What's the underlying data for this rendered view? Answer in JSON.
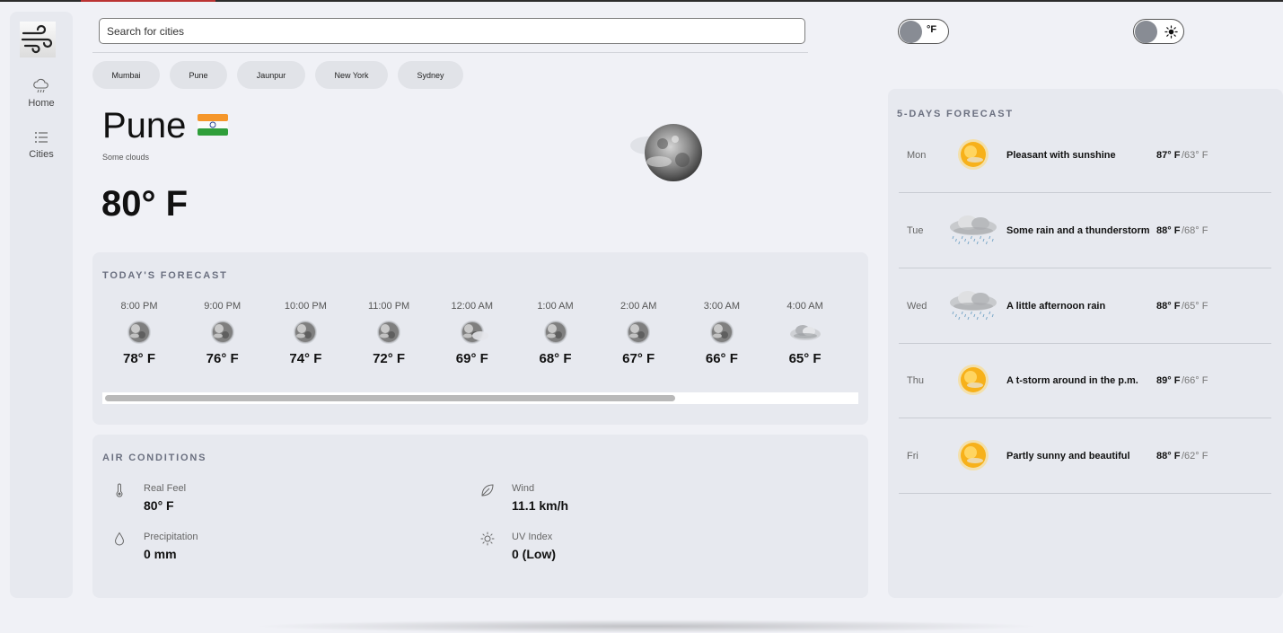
{
  "sidebar": {
    "logo_icon": "wind-icon",
    "items": [
      {
        "label": "Home",
        "icon": "cloud-rain-icon"
      },
      {
        "label": "Cities",
        "icon": "list-icon"
      }
    ]
  },
  "search": {
    "placeholder": "Search for cities",
    "value": ""
  },
  "quick_cities": [
    "Mumbai",
    "Pune",
    "Jaunpur",
    "New York",
    "Sydney"
  ],
  "toggles": {
    "unit_label": "°F",
    "theme_icon": "sun-icon"
  },
  "current": {
    "city": "Pune",
    "flag": "india-flag-icon",
    "description": "Some clouds",
    "temperature": "80° F",
    "icon": "cloudy-moon-icon"
  },
  "today": {
    "title": "TODAY'S FORECAST",
    "hours": [
      {
        "time": "8:00 PM",
        "temp": "78° F",
        "icon": "moon-icon"
      },
      {
        "time": "9:00 PM",
        "temp": "76° F",
        "icon": "moon-icon"
      },
      {
        "time": "10:00 PM",
        "temp": "74° F",
        "icon": "moon-icon"
      },
      {
        "time": "11:00 PM",
        "temp": "72° F",
        "icon": "moon-icon"
      },
      {
        "time": "12:00 AM",
        "temp": "69° F",
        "icon": "moon-cloud-icon"
      },
      {
        "time": "1:00 AM",
        "temp": "68° F",
        "icon": "moon-icon"
      },
      {
        "time": "2:00 AM",
        "temp": "67° F",
        "icon": "moon-icon"
      },
      {
        "time": "3:00 AM",
        "temp": "66° F",
        "icon": "moon-icon"
      },
      {
        "time": "4:00 AM",
        "temp": "65° F",
        "icon": "cloud-icon"
      }
    ],
    "scroll_fraction": 0.76
  },
  "air": {
    "title": "AIR CONDITIONS",
    "metrics": {
      "real_feel": {
        "label": "Real Feel",
        "value": "80° F",
        "icon": "thermometer-icon"
      },
      "wind": {
        "label": "Wind",
        "value": "11.1 km/h",
        "icon": "leaf-icon"
      },
      "precipitation": {
        "label": "Precipitation",
        "value": "0 mm",
        "icon": "droplet-icon"
      },
      "uv_index": {
        "label": "UV Index",
        "value": "0 (Low)",
        "icon": "sun-icon"
      }
    }
  },
  "forecast": {
    "title": "5-DAYS FORECAST",
    "days": [
      {
        "day": "Mon",
        "desc": "Pleasant with sunshine",
        "high": "87° F",
        "low": "/63° F",
        "icon": "sun-icon"
      },
      {
        "day": "Tue",
        "desc": "Some rain and a thunderstorm",
        "high": "88° F",
        "low": "/68° F",
        "icon": "rain-cloud-icon"
      },
      {
        "day": "Wed",
        "desc": "A little afternoon rain",
        "high": "88° F",
        "low": "/65° F",
        "icon": "rain-cloud-icon"
      },
      {
        "day": "Thu",
        "desc": "A t-storm around in the p.m.",
        "high": "89° F",
        "low": "/66° F",
        "icon": "sun-icon"
      },
      {
        "day": "Fri",
        "desc": "Partly sunny and beautiful",
        "high": "88° F",
        "low": "/62° F",
        "icon": "sun-icon"
      }
    ]
  }
}
